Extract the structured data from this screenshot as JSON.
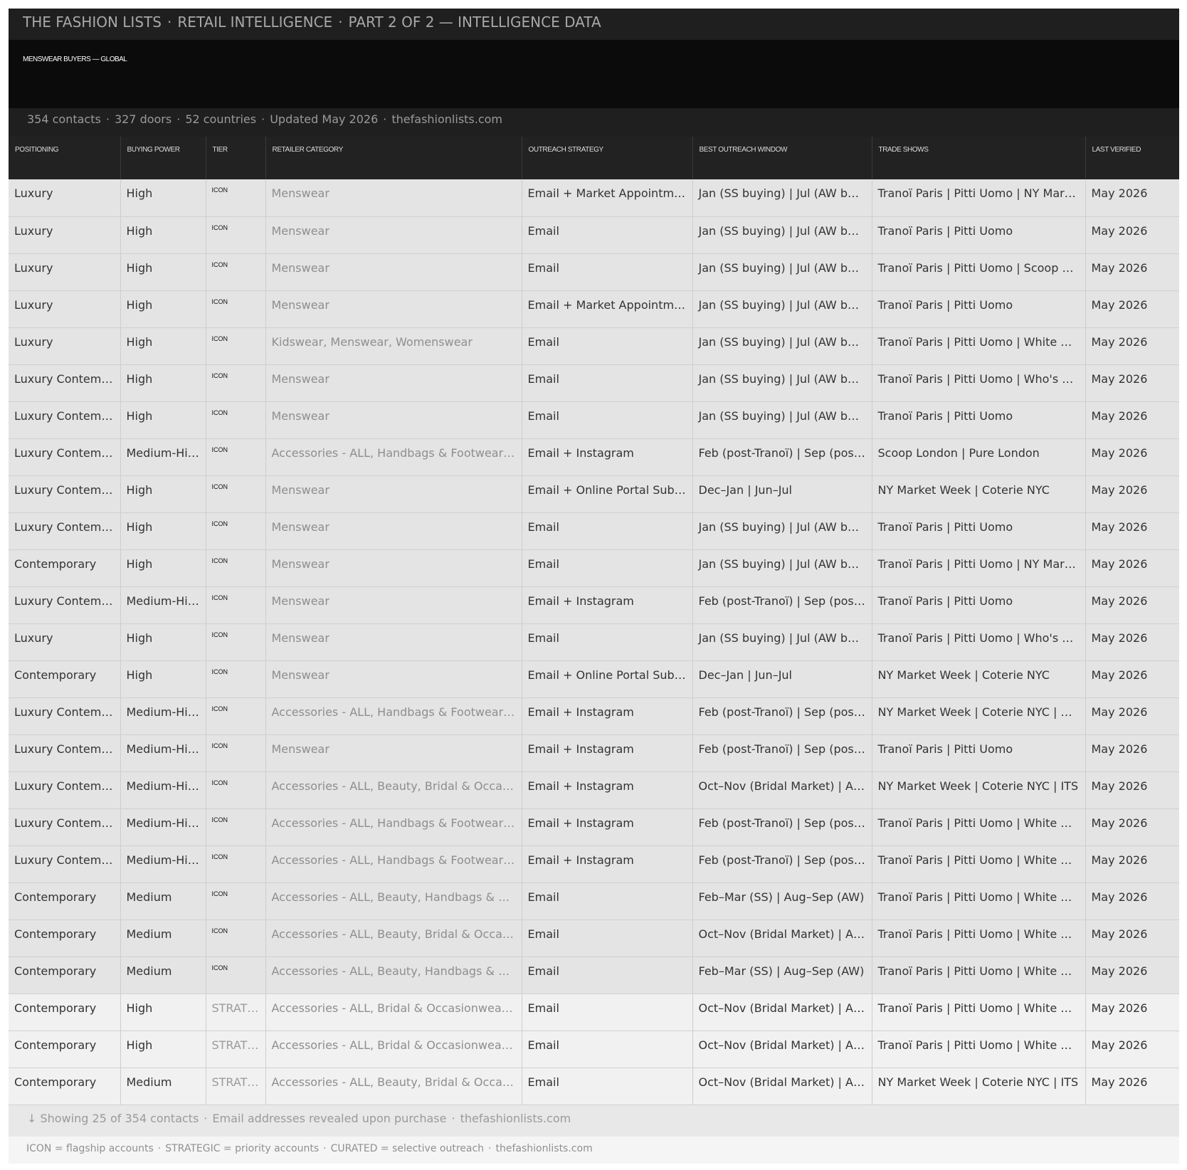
{
  "header": {
    "brand": "THE FASHION LISTS",
    "section": "RETAIL INTELLIGENCE",
    "part": "PART 2 OF 2 — INTELLIGENCE DATA",
    "separator": "·"
  },
  "title": {
    "text": "MENSWEAR BUYERS — GLOBAL"
  },
  "stats": {
    "contacts": "354 contacts",
    "doors": "327 doors",
    "countries": "52 countries",
    "updated": "Updated May 2026",
    "site": "thefashionlists.com"
  },
  "table": {
    "columns": [
      "POSITIONING",
      "BUYING POWER",
      "TIER",
      "RETAILER CATEGORY",
      "OUTREACH STRATEGY",
      "BEST OUTREACH WINDOW",
      "TRADE SHOWS",
      "LAST VERIFIED"
    ],
    "rows": [
      {
        "positioning": "Luxury",
        "power": "High",
        "tier": "ICON",
        "category": "Menswear",
        "outreach": "Email + Market Appointments",
        "window": "Jan (SS buying) | Jul (AW buying)",
        "shows": "Tranoï Paris | Pitti Uomo | NY Market Week",
        "verified": "May 2026"
      },
      {
        "positioning": "Luxury",
        "power": "High",
        "tier": "ICON",
        "category": "Menswear",
        "outreach": "Email",
        "window": "Jan (SS buying) | Jul (AW buying)",
        "shows": "Tranoï Paris | Pitti Uomo",
        "verified": "May 2026"
      },
      {
        "positioning": "Luxury",
        "power": "High",
        "tier": "ICON",
        "category": "Menswear",
        "outreach": "Email",
        "window": "Jan (SS buying) | Jul (AW buying)",
        "shows": "Tranoï Paris | Pitti Uomo | Scoop London",
        "verified": "May 2026"
      },
      {
        "positioning": "Luxury",
        "power": "High",
        "tier": "ICON",
        "category": "Menswear",
        "outreach": "Email + Market Appointments",
        "window": "Jan (SS buying) | Jul (AW buying)",
        "shows": "Tranoï Paris | Pitti Uomo",
        "verified": "May 2026"
      },
      {
        "positioning": "Luxury",
        "power": "High",
        "tier": "ICON",
        "category": "Kidswear, Menswear, Womenswear",
        "outreach": "Email",
        "window": "Jan (SS buying) | Jul (AW buying)",
        "shows": "Tranoï Paris | Pitti Uomo | White Milano",
        "verified": "May 2026"
      },
      {
        "positioning": "Luxury Contemporary",
        "power": "High",
        "tier": "ICON",
        "category": "Menswear",
        "outreach": "Email",
        "window": "Jan (SS buying) | Jul (AW buying)",
        "shows": "Tranoï Paris | Pitti Uomo | Who's Next",
        "verified": "May 2026"
      },
      {
        "positioning": "Luxury Contemporary",
        "power": "High",
        "tier": "ICON",
        "category": "Menswear",
        "outreach": "Email",
        "window": "Jan (SS buying) | Jul (AW buying)",
        "shows": "Tranoï Paris | Pitti Uomo",
        "verified": "May 2026"
      },
      {
        "positioning": "Luxury Contemporary",
        "power": "Medium-High",
        "tier": "ICON",
        "category": "Accessories - ALL, Handbags & Footwear, Menswear",
        "outreach": "Email + Instagram",
        "window": "Feb (post-Tranoï) | Sep (post-Tranoï)",
        "shows": "Scoop London | Pure London",
        "verified": "May 2026"
      },
      {
        "positioning": "Luxury Contemporary",
        "power": "High",
        "tier": "ICON",
        "category": "Menswear",
        "outreach": "Email + Online Portal Submission",
        "window": "Dec–Jan | Jun–Jul",
        "shows": "NY Market Week | Coterie NYC",
        "verified": "May 2026"
      },
      {
        "positioning": "Luxury Contemporary",
        "power": "High",
        "tier": "ICON",
        "category": "Menswear",
        "outreach": "Email",
        "window": "Jan (SS buying) | Jul (AW buying)",
        "shows": "Tranoï Paris | Pitti Uomo",
        "verified": "May 2026"
      },
      {
        "positioning": "Contemporary",
        "power": "High",
        "tier": "ICON",
        "category": "Menswear",
        "outreach": "Email",
        "window": "Jan (SS buying) | Jul (AW buying)",
        "shows": "Tranoï Paris | Pitti Uomo | NY Market Week",
        "verified": "May 2026"
      },
      {
        "positioning": "Luxury Contemporary",
        "power": "Medium-High",
        "tier": "ICON",
        "category": "Menswear",
        "outreach": "Email + Instagram",
        "window": "Feb (post-Tranoï) | Sep (post-Tranoï)",
        "shows": "Tranoï Paris | Pitti Uomo",
        "verified": "May 2026"
      },
      {
        "positioning": "Luxury",
        "power": "High",
        "tier": "ICON",
        "category": "Menswear",
        "outreach": "Email",
        "window": "Jan (SS buying) | Jul (AW buying)",
        "shows": "Tranoï Paris | Pitti Uomo | Who's Next",
        "verified": "May 2026"
      },
      {
        "positioning": "Contemporary",
        "power": "High",
        "tier": "ICON",
        "category": "Menswear",
        "outreach": "Email + Online Portal Submission",
        "window": "Dec–Jan | Jun–Jul",
        "shows": "NY Market Week | Coterie NYC",
        "verified": "May 2026"
      },
      {
        "positioning": "Luxury Contemporary",
        "power": "Medium-High",
        "tier": "ICON",
        "category": "Accessories - ALL, Handbags & Footwear, Menswear",
        "outreach": "Email + Instagram",
        "window": "Feb (post-Tranoï) | Sep (post-Tranoï)",
        "shows": "NY Market Week | Coterie NYC | Capsule",
        "verified": "May 2026"
      },
      {
        "positioning": "Luxury Contemporary",
        "power": "Medium-High",
        "tier": "ICON",
        "category": "Menswear",
        "outreach": "Email + Instagram",
        "window": "Feb (post-Tranoï) | Sep (post-Tranoï)",
        "shows": "Tranoï Paris | Pitti Uomo",
        "verified": "May 2026"
      },
      {
        "positioning": "Luxury Contemporary",
        "power": "Medium-High",
        "tier": "ICON",
        "category": "Accessories - ALL, Beauty, Bridal & Occasionwear",
        "outreach": "Email + Instagram",
        "window": "Oct–Nov (Bridal Market) | Apr–May",
        "shows": "NY Market Week | Coterie NYC | ITS",
        "verified": "May 2026"
      },
      {
        "positioning": "Luxury Contemporary",
        "power": "Medium-High",
        "tier": "ICON",
        "category": "Accessories - ALL, Handbags & Footwear, Menswear",
        "outreach": "Email + Instagram",
        "window": "Feb (post-Tranoï) | Sep (post-Tranoï)",
        "shows": "Tranoï Paris | Pitti Uomo | White Milano",
        "verified": "May 2026"
      },
      {
        "positioning": "Luxury Contemporary",
        "power": "Medium-High",
        "tier": "ICON",
        "category": "Accessories - ALL, Handbags & Footwear, Menswear",
        "outreach": "Email + Instagram",
        "window": "Feb (post-Tranoï) | Sep (post-Tranoï)",
        "shows": "Tranoï Paris | Pitti Uomo | White Milano",
        "verified": "May 2026"
      },
      {
        "positioning": "Contemporary",
        "power": "Medium",
        "tier": "ICON",
        "category": "Accessories - ALL, Beauty, Handbags & Footwear",
        "outreach": "Email",
        "window": "Feb–Mar (SS) | Aug–Sep (AW)",
        "shows": "Tranoï Paris | Pitti Uomo | White Milano",
        "verified": "May 2026"
      },
      {
        "positioning": "Contemporary",
        "power": "Medium",
        "tier": "ICON",
        "category": "Accessories - ALL, Beauty, Bridal & Occasionwear",
        "outreach": "Email",
        "window": "Oct–Nov (Bridal Market) | Apr–May",
        "shows": "Tranoï Paris | Pitti Uomo | White Milano",
        "verified": "May 2026"
      },
      {
        "positioning": "Contemporary",
        "power": "Medium",
        "tier": "ICON",
        "category": "Accessories - ALL, Beauty, Handbags & Footwear",
        "outreach": "Email",
        "window": "Feb–Mar (SS) | Aug–Sep (AW)",
        "shows": "Tranoï Paris | Pitti Uomo | White Milano",
        "verified": "May 2026"
      },
      {
        "positioning": "Contemporary",
        "power": "High",
        "tier": "STRATEGIC",
        "category": "Accessories - ALL, Bridal & Occasionwear, Menswear",
        "outreach": "Email",
        "window": "Oct–Nov (Bridal Market) | Apr–May",
        "shows": "Tranoï Paris | Pitti Uomo | White Milano",
        "verified": "May 2026"
      },
      {
        "positioning": "Contemporary",
        "power": "High",
        "tier": "STRATEGIC",
        "category": "Accessories - ALL, Bridal & Occasionwear, Menswear",
        "outreach": "Email",
        "window": "Oct–Nov (Bridal Market) | Apr–May",
        "shows": "Tranoï Paris | Pitti Uomo | White Milano",
        "verified": "May 2026"
      },
      {
        "positioning": "Contemporary",
        "power": "Medium",
        "tier": "STRATEGIC",
        "category": "Accessories - ALL, Beauty, Bridal & Occasionwear",
        "outreach": "Email",
        "window": "Oct–Nov (Bridal Market) | Apr–May",
        "shows": "NY Market Week | Coterie NYC | ITS",
        "verified": "May 2026"
      }
    ]
  },
  "footer": {
    "arrow": "↓",
    "showing": "Showing 25 of 354 contacts",
    "note": "Email addresses revealed upon purchase",
    "site": "thefashionlists.com"
  },
  "legend": {
    "icon": "ICON = flagship accounts",
    "strategic": "STRATEGIC = priority accounts",
    "curated": "CURATED = selective outreach",
    "site": "thefashionlists.com"
  }
}
